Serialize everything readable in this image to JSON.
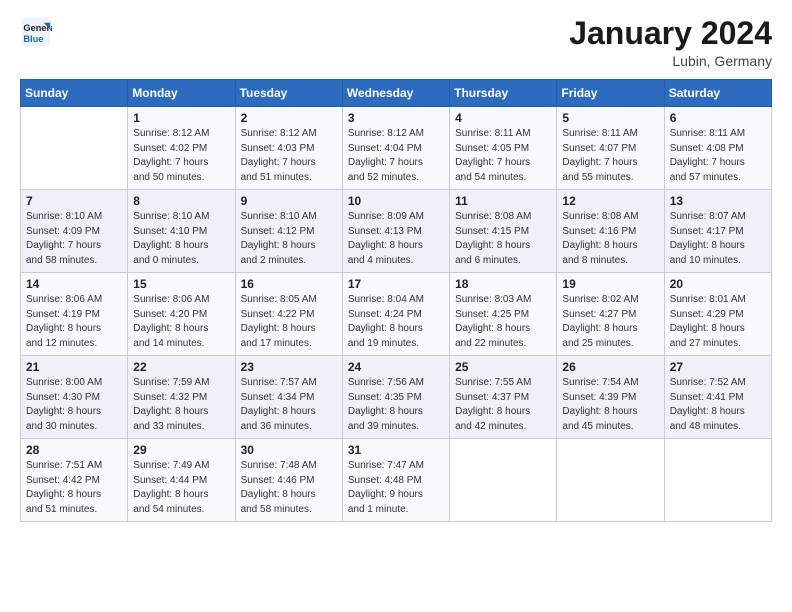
{
  "header": {
    "logo_line1": "General",
    "logo_line2": "Blue",
    "title": "January 2024",
    "location": "Lubin, Germany"
  },
  "columns": [
    "Sunday",
    "Monday",
    "Tuesday",
    "Wednesday",
    "Thursday",
    "Friday",
    "Saturday"
  ],
  "weeks": [
    [
      {
        "day": "",
        "info": ""
      },
      {
        "day": "1",
        "info": "Sunrise: 8:12 AM\nSunset: 4:02 PM\nDaylight: 7 hours\nand 50 minutes."
      },
      {
        "day": "2",
        "info": "Sunrise: 8:12 AM\nSunset: 4:03 PM\nDaylight: 7 hours\nand 51 minutes."
      },
      {
        "day": "3",
        "info": "Sunrise: 8:12 AM\nSunset: 4:04 PM\nDaylight: 7 hours\nand 52 minutes."
      },
      {
        "day": "4",
        "info": "Sunrise: 8:11 AM\nSunset: 4:05 PM\nDaylight: 7 hours\nand 54 minutes."
      },
      {
        "day": "5",
        "info": "Sunrise: 8:11 AM\nSunset: 4:07 PM\nDaylight: 7 hours\nand 55 minutes."
      },
      {
        "day": "6",
        "info": "Sunrise: 8:11 AM\nSunset: 4:08 PM\nDaylight: 7 hours\nand 57 minutes."
      }
    ],
    [
      {
        "day": "7",
        "info": "Sunrise: 8:10 AM\nSunset: 4:09 PM\nDaylight: 7 hours\nand 58 minutes."
      },
      {
        "day": "8",
        "info": "Sunrise: 8:10 AM\nSunset: 4:10 PM\nDaylight: 8 hours\nand 0 minutes."
      },
      {
        "day": "9",
        "info": "Sunrise: 8:10 AM\nSunset: 4:12 PM\nDaylight: 8 hours\nand 2 minutes."
      },
      {
        "day": "10",
        "info": "Sunrise: 8:09 AM\nSunset: 4:13 PM\nDaylight: 8 hours\nand 4 minutes."
      },
      {
        "day": "11",
        "info": "Sunrise: 8:08 AM\nSunset: 4:15 PM\nDaylight: 8 hours\nand 6 minutes."
      },
      {
        "day": "12",
        "info": "Sunrise: 8:08 AM\nSunset: 4:16 PM\nDaylight: 8 hours\nand 8 minutes."
      },
      {
        "day": "13",
        "info": "Sunrise: 8:07 AM\nSunset: 4:17 PM\nDaylight: 8 hours\nand 10 minutes."
      }
    ],
    [
      {
        "day": "14",
        "info": "Sunrise: 8:06 AM\nSunset: 4:19 PM\nDaylight: 8 hours\nand 12 minutes."
      },
      {
        "day": "15",
        "info": "Sunrise: 8:06 AM\nSunset: 4:20 PM\nDaylight: 8 hours\nand 14 minutes."
      },
      {
        "day": "16",
        "info": "Sunrise: 8:05 AM\nSunset: 4:22 PM\nDaylight: 8 hours\nand 17 minutes."
      },
      {
        "day": "17",
        "info": "Sunrise: 8:04 AM\nSunset: 4:24 PM\nDaylight: 8 hours\nand 19 minutes."
      },
      {
        "day": "18",
        "info": "Sunrise: 8:03 AM\nSunset: 4:25 PM\nDaylight: 8 hours\nand 22 minutes."
      },
      {
        "day": "19",
        "info": "Sunrise: 8:02 AM\nSunset: 4:27 PM\nDaylight: 8 hours\nand 25 minutes."
      },
      {
        "day": "20",
        "info": "Sunrise: 8:01 AM\nSunset: 4:29 PM\nDaylight: 8 hours\nand 27 minutes."
      }
    ],
    [
      {
        "day": "21",
        "info": "Sunrise: 8:00 AM\nSunset: 4:30 PM\nDaylight: 8 hours\nand 30 minutes."
      },
      {
        "day": "22",
        "info": "Sunrise: 7:59 AM\nSunset: 4:32 PM\nDaylight: 8 hours\nand 33 minutes."
      },
      {
        "day": "23",
        "info": "Sunrise: 7:57 AM\nSunset: 4:34 PM\nDaylight: 8 hours\nand 36 minutes."
      },
      {
        "day": "24",
        "info": "Sunrise: 7:56 AM\nSunset: 4:35 PM\nDaylight: 8 hours\nand 39 minutes."
      },
      {
        "day": "25",
        "info": "Sunrise: 7:55 AM\nSunset: 4:37 PM\nDaylight: 8 hours\nand 42 minutes."
      },
      {
        "day": "26",
        "info": "Sunrise: 7:54 AM\nSunset: 4:39 PM\nDaylight: 8 hours\nand 45 minutes."
      },
      {
        "day": "27",
        "info": "Sunrise: 7:52 AM\nSunset: 4:41 PM\nDaylight: 8 hours\nand 48 minutes."
      }
    ],
    [
      {
        "day": "28",
        "info": "Sunrise: 7:51 AM\nSunset: 4:42 PM\nDaylight: 8 hours\nand 51 minutes."
      },
      {
        "day": "29",
        "info": "Sunrise: 7:49 AM\nSunset: 4:44 PM\nDaylight: 8 hours\nand 54 minutes."
      },
      {
        "day": "30",
        "info": "Sunrise: 7:48 AM\nSunset: 4:46 PM\nDaylight: 8 hours\nand 58 minutes."
      },
      {
        "day": "31",
        "info": "Sunrise: 7:47 AM\nSunset: 4:48 PM\nDaylight: 9 hours\nand 1 minute."
      },
      {
        "day": "",
        "info": ""
      },
      {
        "day": "",
        "info": ""
      },
      {
        "day": "",
        "info": ""
      }
    ]
  ]
}
